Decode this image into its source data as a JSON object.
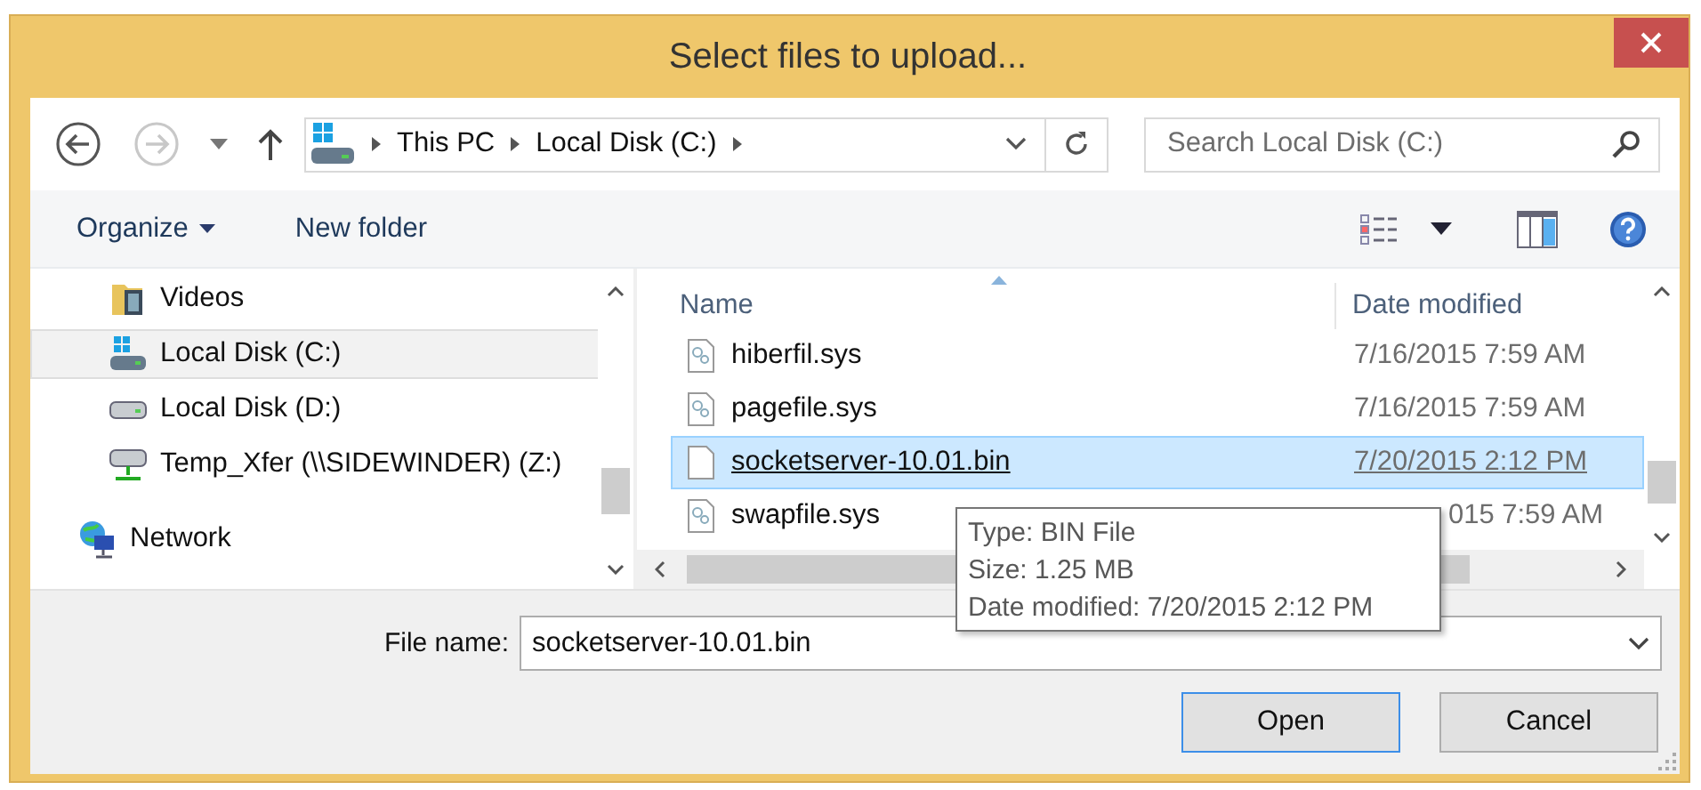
{
  "window": {
    "title": "Select files to upload..."
  },
  "address_bar": {
    "crumbs": [
      "This PC",
      "Local Disk (C:)"
    ]
  },
  "search": {
    "placeholder": "Search Local Disk (C:)"
  },
  "toolbar": {
    "organize": "Organize",
    "new_folder": "New folder"
  },
  "sidebar": {
    "tree": [
      {
        "children": [
          {
            "label": "Videos",
            "kind": "video-folder",
            "selected": false
          },
          {
            "label": "Local Disk (C:)",
            "kind": "system-drive",
            "selected": true
          },
          {
            "label": "Local Disk (D:)",
            "kind": "drive",
            "selected": false
          },
          {
            "label": "Temp_Xfer (\\\\SIDEWINDER) (Z:)",
            "kind": "network-drive",
            "selected": false
          }
        ]
      },
      {
        "label": "Network",
        "kind": "network",
        "selected": false
      }
    ]
  },
  "file_list": {
    "columns": [
      "Name",
      "Date modified"
    ],
    "rows": [
      {
        "name": "hiberfil.sys",
        "date": "7/16/2015 7:59 AM",
        "kind": "system",
        "selected": false,
        "partly_covered": false
      },
      {
        "name": "pagefile.sys",
        "date": "7/16/2015 7:59 AM",
        "kind": "system",
        "selected": false,
        "partly_covered": false
      },
      {
        "name": "socketserver-10.01.bin",
        "date": "7/20/2015 2:12 PM",
        "kind": "blank",
        "selected": true,
        "partly_covered": false
      },
      {
        "name": "swapfile.sys",
        "date": "015 7:59 AM",
        "kind": "system",
        "selected": false,
        "partly_covered": true
      }
    ]
  },
  "tooltip": {
    "lines": [
      "Type: BIN File",
      "Size: 1.25 MB",
      "Date modified: 7/20/2015 2:12 PM"
    ]
  },
  "file_name": {
    "label": "File name:",
    "value": "socketserver-10.01.bin"
  },
  "buttons": [
    {
      "label": "Open",
      "default": true
    },
    {
      "label": "Cancel",
      "default": false
    }
  ]
}
